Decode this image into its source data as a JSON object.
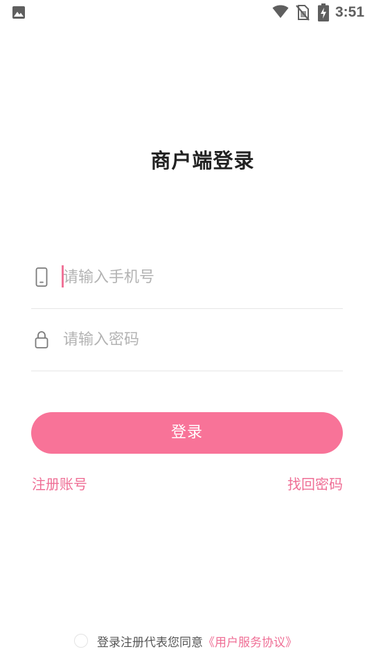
{
  "status_bar": {
    "time": "3:51",
    "icons": [
      "gallery-icon",
      "wifi-icon",
      "no-sim-icon",
      "battery-charging-icon"
    ]
  },
  "title": "商户端登录",
  "phone_field": {
    "placeholder": "请输入手机号",
    "value": "",
    "icon": "phone-icon"
  },
  "password_field": {
    "placeholder": "请输入密码",
    "value": "",
    "icon": "lock-icon"
  },
  "login_button": {
    "label": "登录"
  },
  "links": {
    "register": "注册账号",
    "forgot_password": "找回密码"
  },
  "agreement": {
    "text": "登录注册代表您同意",
    "link": "《用户服务协议》",
    "checked": false
  },
  "colors": {
    "accent": "#f87398",
    "link": "#ef6e95",
    "placeholder": "#b3b3b3",
    "divider": "#e6e6e6"
  }
}
